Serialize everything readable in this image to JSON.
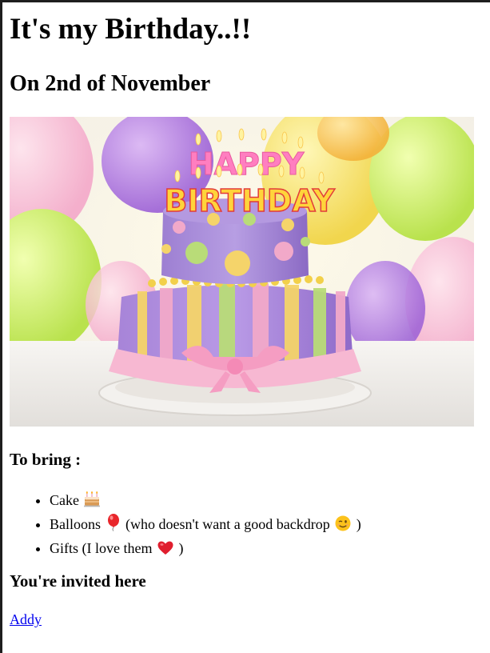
{
  "page": {
    "title": "It's my Birthday..!!",
    "subtitle": "On 2nd of November"
  },
  "image": {
    "alt": "Birthday cake with Happy Birthday candles in front of colorful balloons",
    "caption_top": "HAPPY",
    "caption_bottom": "BIRTHDAY"
  },
  "bring": {
    "heading": "To bring :",
    "items": [
      {
        "text": "Cake",
        "icon": "birthday-cake-icon",
        "suffix": ""
      },
      {
        "text": "Balloons",
        "icon": "balloon-icon",
        "suffix": "(who doesn't want a good backdrop",
        "icon2": "wink-face-icon",
        "end": ")"
      },
      {
        "text": "Gifts (I love them",
        "icon": "red-heart-icon",
        "end": ")"
      }
    ]
  },
  "invite": {
    "heading": "You're invited here",
    "link_text": "Addy"
  },
  "colors": {
    "link": "#0000ee",
    "window_border": "#1e1e1e"
  }
}
